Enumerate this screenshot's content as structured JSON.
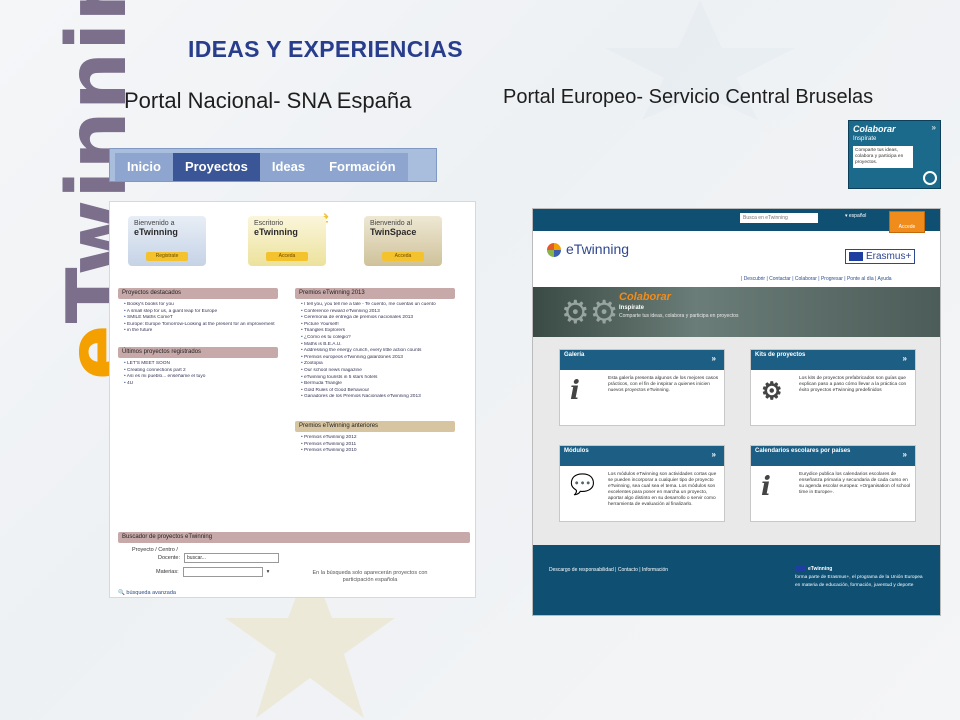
{
  "logo": {
    "prefix": "e",
    "rest": "Twinning"
  },
  "slide": {
    "title": "IDEAS Y EXPERIENCIAS",
    "left_heading": "Portal Nacional- SNA España",
    "right_heading": "Portal Europeo- Servicio Central Bruselas"
  },
  "sna": {
    "nav": [
      "Inicio",
      "Proyectos",
      "Ideas",
      "Formación"
    ],
    "active_nav": "Proyectos",
    "cards": [
      {
        "small": "Bienvenido a",
        "big": "eTwinning",
        "button": "Registrate"
      },
      {
        "small": "Escritorio",
        "big": "eTwinning",
        "button": "Acceda"
      },
      {
        "small": "Bienvenido al",
        "big": "TwinSpace",
        "button": "Acceda"
      }
    ],
    "destacados": {
      "title": "Proyectos destacados",
      "items": [
        "Booky's books for you",
        "A small step for us, a giant leap for Europe",
        "SMILE Maths ComeT",
        "Europe: Europe Tomorrow-Looking at the present for an improvement",
        "in the future"
      ]
    },
    "ultimos": {
      "title": "Últimos proyectos registrados",
      "items": [
        "LET'S MEET SOON",
        "Creating connections part 2",
        "Así es mi pueblo... enséñame el tuyo",
        "4U"
      ]
    },
    "premios": {
      "title": "Premios eTwinning 2013",
      "items": [
        "I tell you, you tell me a tale - Te cuento, me cuentas un cuento",
        "Conference reward eTwinning 2013",
        "Ceremonia de entrega de premios nacionales 2013",
        "Picture Yourself!",
        "Triangles Explorers",
        "¿Cómo es tu colegio?",
        "Maths is B.E.A.U.",
        "Addressing the energy crunch, every little action counts",
        "Premios europeos eTwinning galardones 2013",
        "Zootopia",
        "Our school news magazine",
        "eTwinning tourists in 5 stars hotels",
        "Bermuda Triangle",
        "Gold Rules of Good Behaviour",
        "Ganadores de los Premios Nacionales eTwinning 2013"
      ]
    },
    "anteriores": {
      "title": "Premios eTwinning anteriores",
      "items": [
        "Premios eTwinning 2012",
        "Premios eTwinning 2011",
        "Premios eTwinning 2010"
      ]
    },
    "buscador": {
      "title": "Buscador de proyectos eTwinning",
      "label_proyecto": "Proyecto / Centro /",
      "label_docente": "Docente:",
      "input_value": "buscar...",
      "label_materias": "Materias:",
      "note": "En la búsqueda solo aparecerán proyectos con participación española",
      "advanced": "búsqueda avanzada"
    }
  },
  "colaborar_badge": {
    "title": "Colaborar",
    "chev": "»",
    "sub": "Inspírate",
    "text": "Comparte tus ideas, colabora y participa en proyectos."
  },
  "eu": {
    "search_placeholder": "Busca en eTwinning",
    "lang": "▾ español",
    "access": "Accede",
    "logo": "eTwinning",
    "erasmus": "Erasmus+",
    "nav": "|  Descubrir  |  Contactar  |  Colaborar  |  Progresar  |  Ponte al día  |  Ayuda",
    "banner": {
      "title": "Colaborar",
      "sub": "Inspírate",
      "text": "Comparte tus ideas, colabora y participa en proyectos"
    },
    "tiles": [
      {
        "title": "Galería",
        "icon": "i",
        "text": "Esta galería presenta algunos de los mejores casos prácticos, con el fin de inspirar a quienes inicien nuevos proyectos eTwinning."
      },
      {
        "title": "Kits de proyectos",
        "icon": "⚙",
        "text": "Los kits de proyectos prefabricados son guías que explican paso a paso cómo llevar a la práctica con éxito proyectos eTwinning predefinidos"
      },
      {
        "title": "Módulos",
        "icon": "💬",
        "text": "Los módulos eTwinning son actividades cortas que se pueden incorporar a cualquier tipo de proyecto eTwinning, sea cual sea el tema. Los módulos son excelentes para poner en marcha un proyecto, aportar algo distinto en su desarrollo o servir como herramienta de evaluación al finalizarlo."
      },
      {
        "title": "Calendarios escolares por países",
        "icon": "i",
        "text": "Eurydice publica los calendarios escolares de enseñanza primaria y secundaria de cada curso en su agenda escolar europea: «Organisation of school time in Europe»."
      }
    ],
    "footer": {
      "links": "Descargo de responsabilidad  |  Contacto  |  Información",
      "brand": "eTwinning",
      "text": "forma parte de Erasmus+, el programa de la Unión Europea en materia de educación, formación, juventud y deporte"
    }
  }
}
